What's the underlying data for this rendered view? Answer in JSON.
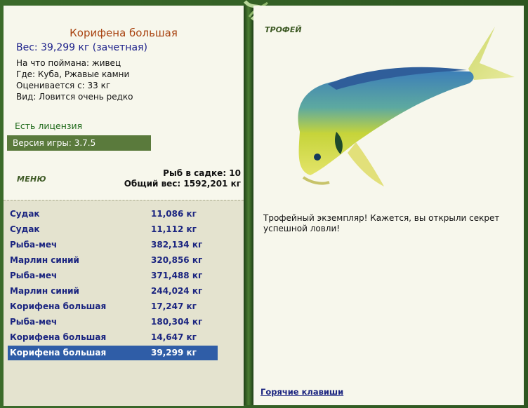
{
  "fish": {
    "name": "Корифена большая",
    "weight_line": "Вес: 39,299 кг (зачетная)",
    "bait": "На что поймана: живец",
    "location": "Где: Куба, Ржавые камни",
    "min_weight": "Оценивается с: 33 кг",
    "rarity": "Вид: Ловится очень редко"
  },
  "license_text": "Есть лицензия",
  "version_text": "Версия игры: 3.7.5",
  "menu_label": "МЕНЮ",
  "keepnet": {
    "count_line": "Рыб в садке: 10",
    "total_line": "Общий вес: 1592,201 кг"
  },
  "catches": [
    {
      "name": "Судак",
      "weight": "11,086 кг"
    },
    {
      "name": "Судак",
      "weight": "11,112 кг"
    },
    {
      "name": "Рыба-меч",
      "weight": "382,134 кг"
    },
    {
      "name": "Марлин синий",
      "weight": "320,856 кг"
    },
    {
      "name": "Рыба-меч",
      "weight": "371,488 кг"
    },
    {
      "name": "Марлин синий",
      "weight": "244,024 кг"
    },
    {
      "name": "Корифена большая",
      "weight": "17,247 кг"
    },
    {
      "name": "Рыба-меч",
      "weight": "180,304 кг"
    },
    {
      "name": "Корифена большая",
      "weight": "14,647 кг"
    },
    {
      "name": "Корифена большая",
      "weight": "39,299 кг"
    }
  ],
  "selected_index": 9,
  "trophy_label": "ТРОФЕЙ",
  "trophy_message": "Трофейный экземпляр! Кажется, вы открыли секрет успешной ловли!",
  "hotkeys_link": "Горячие клавиши",
  "colors": {
    "selection": "#2f5da7",
    "fish_name": "#a94412",
    "link": "#1b2580"
  }
}
